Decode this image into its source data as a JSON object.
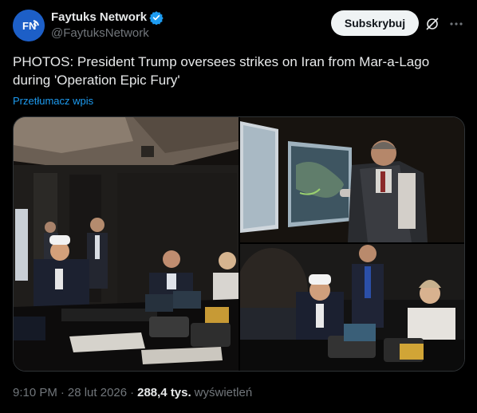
{
  "author": {
    "display_name": "Faytuks Network",
    "handle": "@FaytuksNetwork",
    "avatar_text": "FN",
    "verified": true
  },
  "actions": {
    "subscribe_label": "Subskrybuj"
  },
  "post": {
    "text": "PHOTOS: President Trump oversees strikes on Iran from Mar-a-Lago during 'Operation Epic Fury'",
    "translate_label": "Przetłumacz wpis"
  },
  "media": {
    "count": 3,
    "items": [
      "photo-situation-room-wide",
      "photo-map-briefing",
      "photo-table-closeup"
    ]
  },
  "meta": {
    "time": "9:10 PM",
    "separator": "·",
    "date": "28 lut 2026",
    "views_count": "288,4 tys.",
    "views_label": "wyświetleń"
  },
  "colors": {
    "background": "#000000",
    "accent": "#1d9bf0",
    "muted": "#71767b",
    "text": "#e7e9ea",
    "button_bg": "#eff3f4"
  }
}
